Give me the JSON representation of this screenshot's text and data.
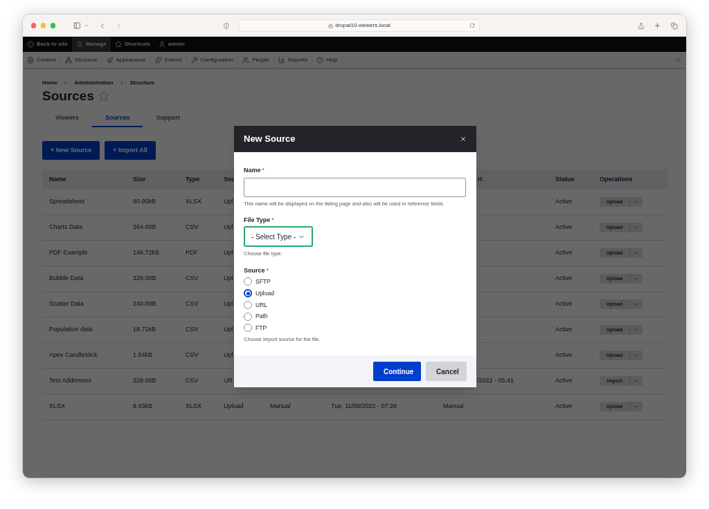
{
  "browser": {
    "url": "drupal10-viewers.local"
  },
  "admin_toolbar": {
    "items": [
      {
        "label": "Back to site",
        "selected": false
      },
      {
        "label": "Manage",
        "selected": true
      },
      {
        "label": "Shortcuts",
        "selected": false
      },
      {
        "label": "admin",
        "selected": false
      }
    ]
  },
  "admin_menu": {
    "items": [
      "Content",
      "Structure",
      "Appearance",
      "Extend",
      "Configuration",
      "People",
      "Reports",
      "Help"
    ]
  },
  "breadcrumb": [
    "Home",
    "Administration",
    "Structure"
  ],
  "page_title": "Sources",
  "tabs": [
    {
      "label": "Viewers",
      "selected": false
    },
    {
      "label": "Sources",
      "selected": true
    },
    {
      "label": "Support",
      "selected": false
    }
  ],
  "actions": [
    "+ New Source",
    "+ Import All"
  ],
  "table": {
    "columns": {
      "name": "Name",
      "size": "Size",
      "type": "Type",
      "column_4": "Sou",
      "column_7": "rt",
      "status": "Status",
      "operations": "Operations"
    },
    "rows": [
      {
        "name": "Spreadsheet",
        "size": "80.95kB",
        "type": "XLSX",
        "column_4": "Upl",
        "status": "Active",
        "operation": "Upload"
      },
      {
        "name": "Charts Data",
        "size": "364.00B",
        "type": "CSV",
        "column_4": "Upl",
        "status": "Active",
        "operation": "Upload"
      },
      {
        "name": "PDF Example",
        "size": "146.72kB",
        "type": "PDF",
        "column_4": "Upl",
        "status": "Active",
        "operation": "Upload"
      },
      {
        "name": "Bubble Data",
        "size": "329.00B",
        "type": "CSV",
        "column_4": "Upl",
        "status": "Active",
        "operation": "Upload"
      },
      {
        "name": "Scatter Data",
        "size": "240.00B",
        "type": "CSV",
        "column_4": "Upl",
        "status": "Active",
        "operation": "Upload"
      },
      {
        "name": "Population data",
        "size": "18.71kB",
        "type": "CSV",
        "column_4": "Upl",
        "status": "Active",
        "operation": "Upload"
      },
      {
        "name": "Apex Candlestick",
        "size": "1.54kB",
        "type": "CSV",
        "column_4": "Upl",
        "status": "Active",
        "operation": "Upload"
      },
      {
        "name": "Test Addresses",
        "size": "328.00B",
        "type": "CSV",
        "column_4": "UR",
        "column_7": "/2022 - 05:41",
        "status": "Active",
        "operation": "Import"
      },
      {
        "name": "XLSX",
        "size": "8.93kB",
        "type": "XLSX",
        "column_4": "Upload",
        "column_5": "Manual",
        "column_6": "Tue, 11/08/2022 - 07:28",
        "column_7": "Manual",
        "status": "Active",
        "operation": "Upload"
      }
    ]
  },
  "modal": {
    "title": "New Source",
    "fields": [
      {
        "kind": "text",
        "label": "Name",
        "required_mark": "*",
        "description": "This name will be displayed on the listing page and also will be used in reference fields."
      },
      {
        "kind": "select",
        "label": "File Type",
        "required_mark": "*",
        "value": "- Select Type -",
        "focused": true,
        "description": "Choose file type."
      },
      {
        "kind": "radios",
        "label": "Source",
        "required_mark": "*",
        "options": [
          {
            "label": "SFTP",
            "selected": false
          },
          {
            "label": "Upload",
            "selected": true
          },
          {
            "label": "URL",
            "selected": false
          },
          {
            "label": "Path",
            "selected": false
          },
          {
            "label": "FTP",
            "selected": false
          }
        ],
        "description": "Choose import source for the file."
      }
    ],
    "buttons": [
      {
        "label": "Continue",
        "kind": "primary"
      },
      {
        "label": "Cancel",
        "kind": "secondary"
      }
    ]
  }
}
